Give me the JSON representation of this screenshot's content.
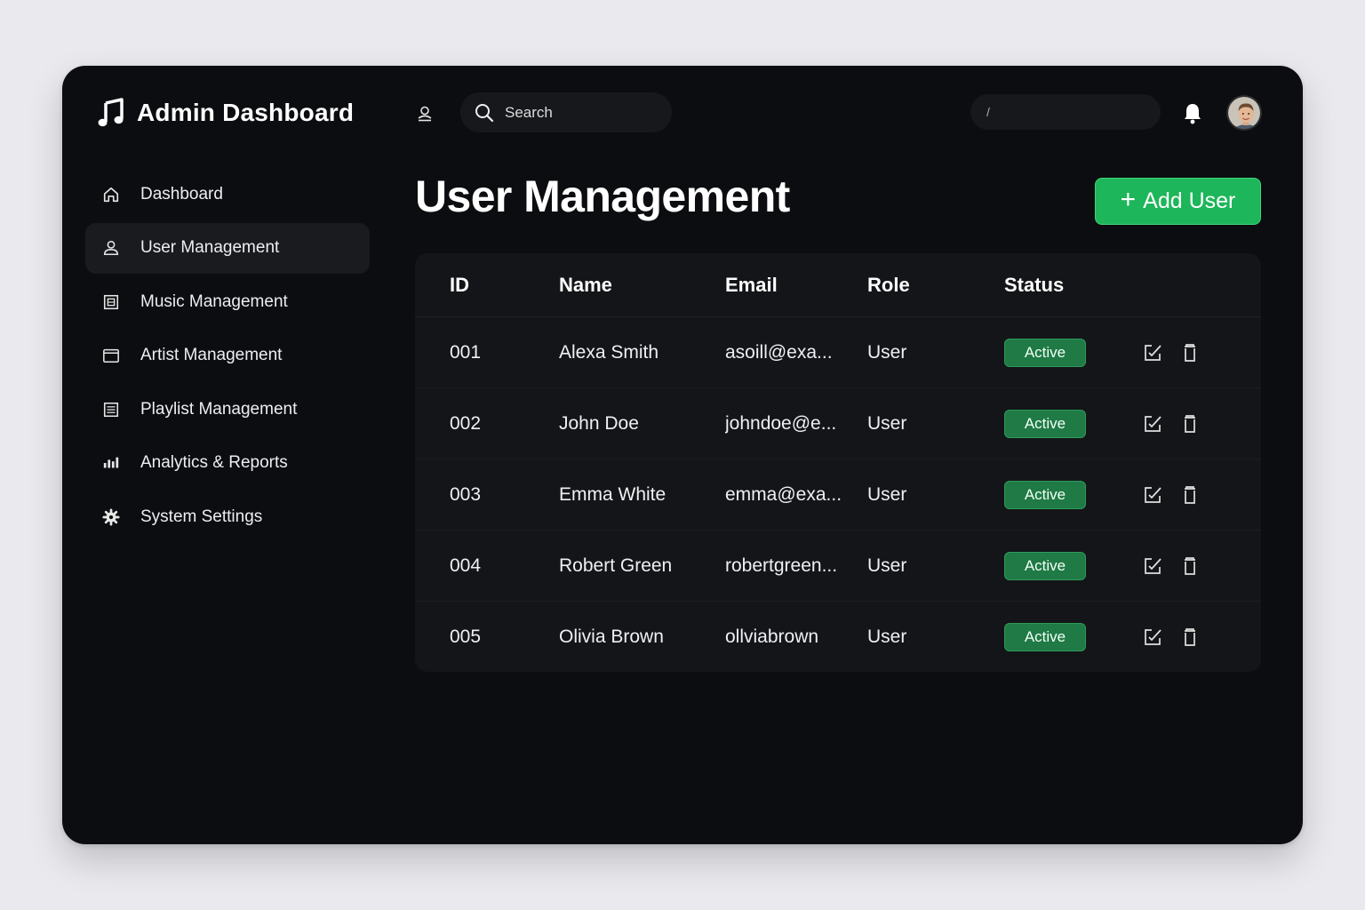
{
  "app": {
    "title": "Admin Dashboard"
  },
  "topbar": {
    "search_placeholder": "Search",
    "secondary_field_text": "/"
  },
  "sidebar": {
    "items": [
      {
        "label": "Dashboard",
        "icon": "home-icon",
        "active": false
      },
      {
        "label": "User Management",
        "icon": "user-icon",
        "active": true
      },
      {
        "label": "Music Management",
        "icon": "music-library-icon",
        "active": false
      },
      {
        "label": "Artist Management",
        "icon": "artist-window-icon",
        "active": false
      },
      {
        "label": "Playlist Management",
        "icon": "playlist-icon",
        "active": false
      },
      {
        "label": "Analytics & Reports",
        "icon": "analytics-icon",
        "active": false
      },
      {
        "label": "System Settings",
        "icon": "gear-icon",
        "active": false
      }
    ]
  },
  "main": {
    "title": "User Management",
    "add_button": {
      "plus": "+",
      "label": "Add User"
    },
    "table": {
      "headers": [
        "ID",
        "Name",
        "Email",
        "Role",
        "Status"
      ],
      "rows": [
        {
          "id": "001",
          "name": "Alexa Smith",
          "email": "asoill@exa...",
          "role": "User",
          "status": "Active"
        },
        {
          "id": "002",
          "name": "John Doe",
          "email": "johndoe@e...",
          "role": "User",
          "status": "Active"
        },
        {
          "id": "003",
          "name": "Emma White",
          "email": "emma@exa...",
          "role": "User",
          "status": "Active"
        },
        {
          "id": "004",
          "name": "Robert Green",
          "email": "robertgreen...",
          "role": "User",
          "status": "Active"
        },
        {
          "id": "005",
          "name": "Olivia Brown",
          "email": "ollviabrown",
          "role": "User",
          "status": "Active"
        }
      ]
    }
  },
  "colors": {
    "background": "#0c0d10",
    "accent": "#1db65a",
    "badge": "#1f7a45"
  }
}
